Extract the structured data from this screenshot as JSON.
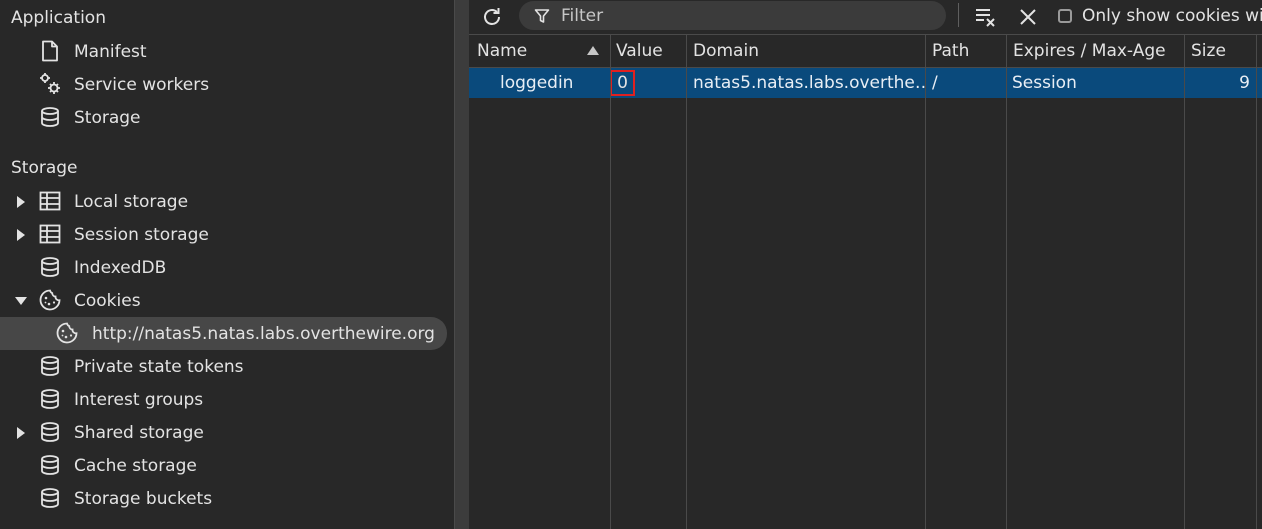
{
  "sidebar": {
    "application_title": "Application",
    "application_items": [
      {
        "label": "Manifest",
        "icon": "document-icon"
      },
      {
        "label": "Service workers",
        "icon": "gears-icon"
      },
      {
        "label": "Storage",
        "icon": "database-icon"
      }
    ],
    "storage_title": "Storage",
    "storage_items": [
      {
        "label": "Local storage",
        "icon": "table-icon",
        "expandable": true,
        "expanded": false
      },
      {
        "label": "Session storage",
        "icon": "table-icon",
        "expandable": true,
        "expanded": false
      },
      {
        "label": "IndexedDB",
        "icon": "database-icon"
      },
      {
        "label": "Cookies",
        "icon": "cookie-icon",
        "expandable": true,
        "expanded": true
      },
      {
        "label": "http://natas5.natas.labs.overthewire.org",
        "icon": "cookie-icon",
        "selected": true
      },
      {
        "label": "Private state tokens",
        "icon": "database-icon"
      },
      {
        "label": "Interest groups",
        "icon": "database-icon"
      },
      {
        "label": "Shared storage",
        "icon": "database-icon",
        "expandable": true,
        "expanded": false
      },
      {
        "label": "Cache storage",
        "icon": "database-icon"
      },
      {
        "label": "Storage buckets",
        "icon": "database-icon"
      }
    ]
  },
  "toolbar": {
    "refresh_icon": "refresh-icon",
    "filter_placeholder": "Filter",
    "filter_value": "",
    "clear_all_icon": "clear-filtered-icon",
    "delete_icon": "close-icon",
    "only_show_label": "Only show cookies wit",
    "only_show_checked": false
  },
  "table": {
    "columns": [
      "Name",
      "Value",
      "Domain",
      "Path",
      "Expires / Max-Age",
      "Size"
    ],
    "sorted_column": "Name",
    "sort_direction": "ascending",
    "rows": [
      {
        "name": "loggedin",
        "value": "0",
        "domain": "natas5.natas.labs.overthe…",
        "path": "/",
        "expires": "Session",
        "size": "9"
      }
    ]
  },
  "colors": {
    "background": "#282828",
    "selected_row": "#0a4a7c",
    "highlight_border": "#e02020",
    "selected_tree_item": "#474747"
  }
}
